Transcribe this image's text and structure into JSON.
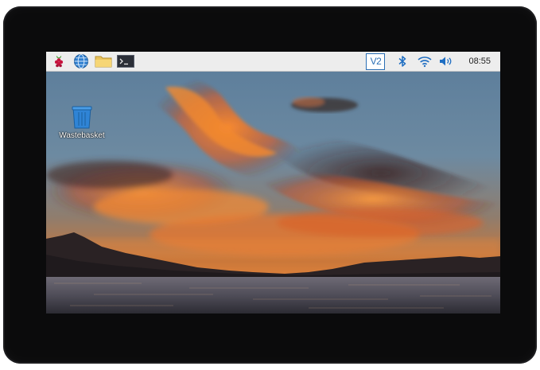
{
  "taskbar": {
    "menu_icon": "raspberry-menu-icon",
    "launchers": [
      "web-browser-icon",
      "file-manager-icon",
      "terminal-icon"
    ],
    "tray": {
      "vnc_label": "V2",
      "bluetooth_icon": "bluetooth-icon",
      "wifi_icon": "wifi-icon",
      "volume_icon": "volume-icon",
      "clock": "08:55"
    },
    "background": "#ededed"
  },
  "desktop": {
    "icons": [
      {
        "label": "Wastebasket",
        "icon": "wastebasket-icon"
      }
    ],
    "wallpaper": "sunset-over-lake"
  },
  "colors": {
    "accent": "#2b6fb5",
    "bezel": "#0b0b0c"
  }
}
